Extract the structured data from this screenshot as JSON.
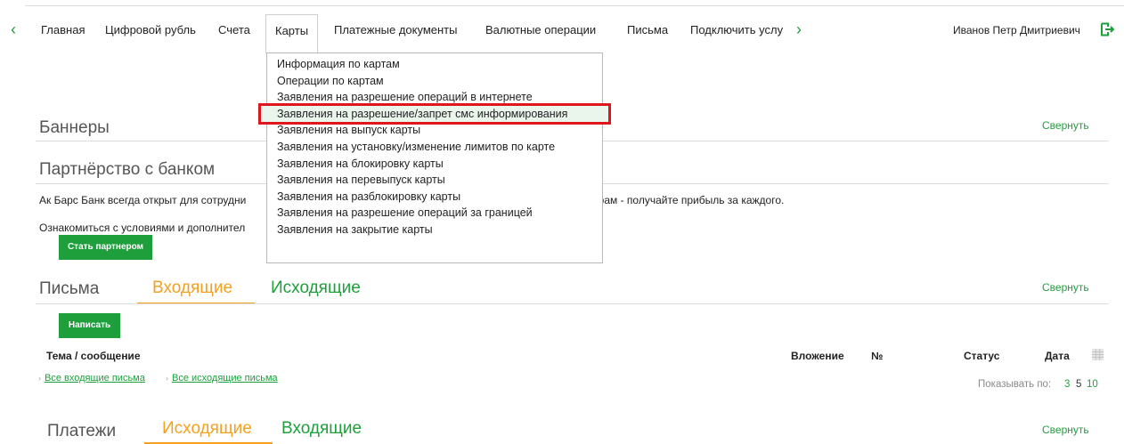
{
  "nav": {
    "prev_arrow": "‹",
    "next_arrow": "›",
    "items": [
      "Главная",
      "Цифровой рубль",
      "Счета",
      "Карты",
      "Платежные документы",
      "Валютные операции",
      "Письма",
      "Подключить услу"
    ],
    "active_item": "Карты",
    "user_name": "Иванов Петр Дмитриевич",
    "logout_icon": "logout-icon"
  },
  "cards_menu": {
    "items": [
      "Информация по картам",
      "Операции по картам",
      "Заявления на разрешение операций в интернете",
      "Заявления на разрешение/запрет смс информирования",
      "Заявления на выпуск карты",
      "Заявления на установку/изменение лимитов по карте",
      "Заявления на блокировку карты",
      "Заявления на перевыпуск карты",
      "Заявления на разблокировку карты",
      "Заявления на разрешение операций за границей",
      "Заявления на закрытие карты"
    ],
    "highlighted_index": 3,
    "highlight_color": "#e0161c"
  },
  "banners": {
    "title": "Баннеры",
    "collapse": "Свернуть",
    "partnership_title": "Партнёрство с банком",
    "text_left": "Ак Барс Банк всегда открыт для сотрудни",
    "text_right": "ёрам - получайте прибыль за каждого.",
    "text2_left": "Ознакомиться с условиями и дополнител",
    "partner_button": "Стать партнером"
  },
  "letters": {
    "title": "Письма",
    "tab_incoming": "Входящие",
    "tab_outgoing": "Исходящие",
    "collapse": "Свернуть",
    "write_button": "Написать",
    "columns": {
      "subject": "Тема / сообщение",
      "attachment": "Вложение",
      "number": "№",
      "status": "Статус",
      "date": "Дата"
    },
    "all_incoming": "Все входящие письма",
    "all_outgoing": "Все исходящие письма",
    "show_by_label": "Показывать по:",
    "page_sizes": [
      "3",
      "5",
      "10"
    ],
    "active_page_size": "5"
  },
  "payments": {
    "title": "Платежи",
    "tab_outgoing": "Исходящие",
    "tab_incoming": "Входящие",
    "collapse": "Свернуть"
  },
  "colors": {
    "accent_green": "#1e9f3c",
    "accent_orange": "#f4a021"
  }
}
